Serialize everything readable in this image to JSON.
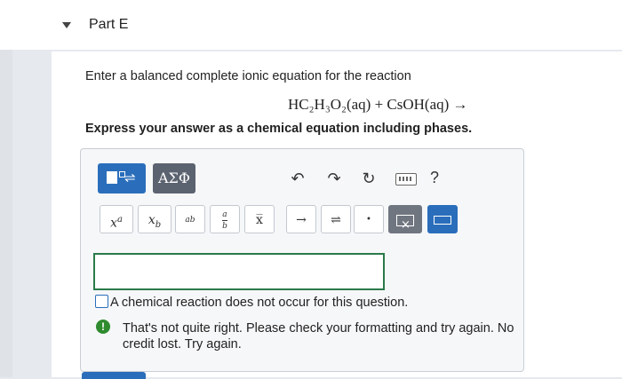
{
  "part": {
    "title": "Part E"
  },
  "question": {
    "prompt": "Enter a balanced complete ionic equation for the reaction",
    "equation": "HC₂H₃O₂(aq) + CsOH(aq) →",
    "instruction": "Express your answer as a chemical equation including phases."
  },
  "toolbar": {
    "greek_label": "ΑΣΦ",
    "undo_icon": "undo-icon",
    "redo_icon": "redo-icon",
    "reset_icon": "reset-icon",
    "keyboard_icon": "keyboard-icon",
    "help_label": "?"
  },
  "keys": {
    "superscript": "x",
    "superscript_exp": "a",
    "subscript": "x",
    "subscript_sub": "b",
    "frac_num": "a",
    "frac_den": "b",
    "vec": "x̅",
    "arrow": "→",
    "equilibrium": "⇌",
    "dot": "•"
  },
  "answer": {
    "value": ""
  },
  "options": {
    "no_reaction_label": "A chemical reaction does not occur for this question."
  },
  "feedback": {
    "icon": "!",
    "message": "That's not quite right. Please check your formatting and try again. No credit lost. Try again."
  },
  "colors": {
    "primary": "#2a6ebb",
    "success": "#2e8b2e",
    "input_border": "#2a7a4a"
  }
}
